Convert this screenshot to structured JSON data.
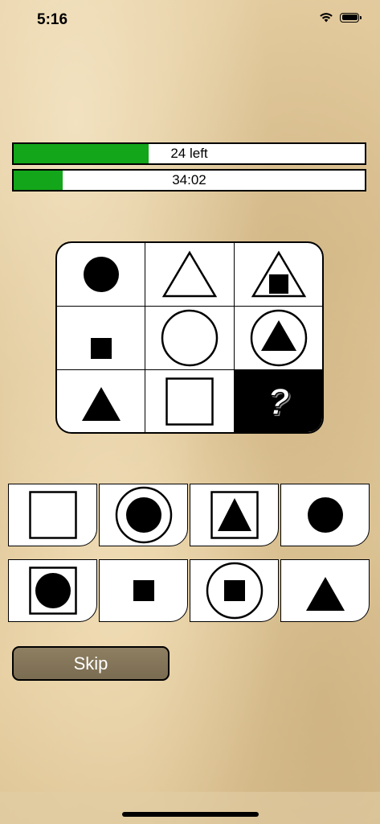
{
  "status_bar": {
    "time": "5:16",
    "battery_level": 1.0
  },
  "progress": {
    "remaining_label": "24 left",
    "remaining_fraction": 0.385,
    "timer_label": "34:02",
    "timer_fraction": 0.14,
    "fill_color": "#13a51a"
  },
  "puzzle": {
    "cells": [
      {
        "figure": "filled-circle"
      },
      {
        "figure": "outline-triangle"
      },
      {
        "figure": "outline-triangle-with-filled-square"
      },
      {
        "figure": "filled-small-square"
      },
      {
        "figure": "outline-circle"
      },
      {
        "figure": "outline-circle-with-filled-triangle"
      },
      {
        "figure": "filled-triangle"
      },
      {
        "figure": "outline-square"
      },
      {
        "figure": "question-mark",
        "text": "?"
      }
    ]
  },
  "options": [
    {
      "figure": "outline-square"
    },
    {
      "figure": "outline-circle-with-filled-circle"
    },
    {
      "figure": "outline-square-with-filled-triangle"
    },
    {
      "figure": "filled-circle"
    },
    {
      "figure": "outline-square-with-filled-circle"
    },
    {
      "figure": "filled-small-square"
    },
    {
      "figure": "outline-circle-with-filled-square"
    },
    {
      "figure": "filled-triangle"
    }
  ],
  "skip_button": {
    "label": "Skip"
  }
}
